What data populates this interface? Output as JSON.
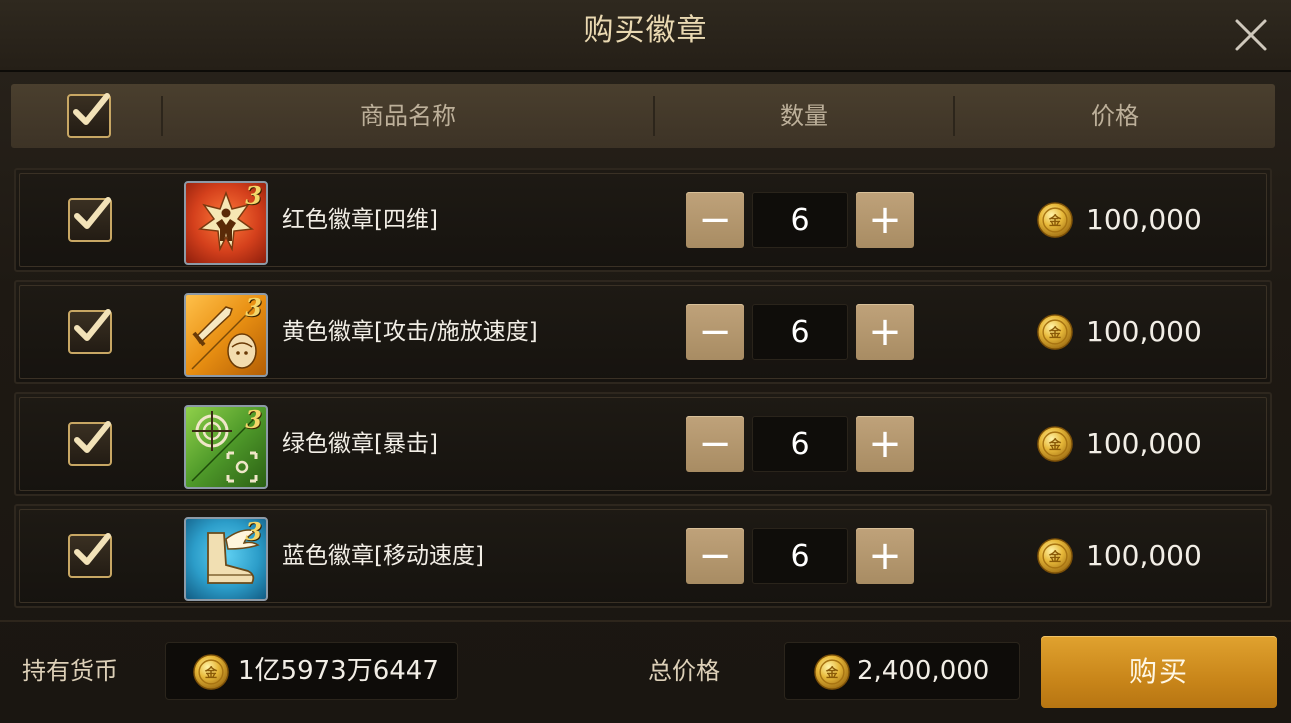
{
  "title": "购买徽章",
  "header": {
    "col_name": "商品名称",
    "col_qty": "数量",
    "col_price": "价格"
  },
  "items": [
    {
      "name": "红色徽章[四维]",
      "level": "3",
      "qty": "6",
      "price": "100,000",
      "color": "#d4401c",
      "icon": "strength-figure-icon"
    },
    {
      "name": "黄色徽章[攻击/施放速度]",
      "level": "3",
      "qty": "6",
      "price": "100,000",
      "color": "#e88f12",
      "icon": "sword-and-head-icon"
    },
    {
      "name": "绿色徽章[暴击]",
      "level": "3",
      "qty": "6",
      "price": "100,000",
      "color": "#4f9a2a",
      "icon": "crosshair-icon"
    },
    {
      "name": "蓝色徽章[移动速度]",
      "level": "3",
      "qty": "6",
      "price": "100,000",
      "color": "#2c9dc9",
      "icon": "winged-boot-icon"
    }
  ],
  "controls": {
    "minus": "−",
    "plus": "+"
  },
  "footer": {
    "held_label": "持有货币",
    "held_value": "1亿5973万6447",
    "total_label": "总价格",
    "total_value": "2,400,000",
    "buy_label": "购买"
  },
  "colors": {
    "accent_gold": "#c8a764",
    "buy_button": "#d08e22"
  }
}
